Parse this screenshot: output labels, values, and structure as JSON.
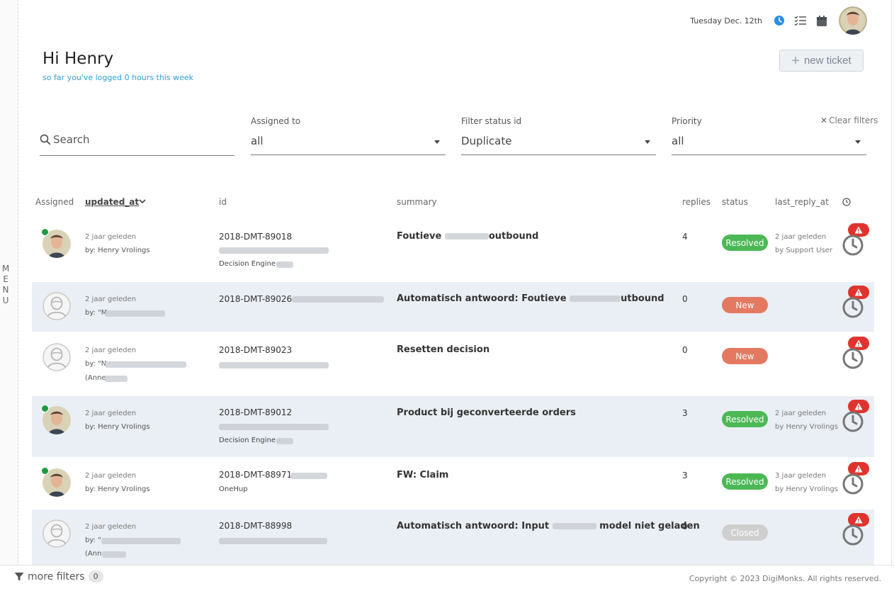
{
  "header": {
    "date": "Tuesday Dec. 12th",
    "greeting": "Hi Henry",
    "subtitle": "so far you've logged 0 hours this week",
    "new_ticket_label": "new ticket",
    "menu_label": "MENU"
  },
  "filters": {
    "search_placeholder": "Search",
    "assigned_label": "Assigned to",
    "assigned_value": "all",
    "status_label": "Filter status id",
    "status_value": "Duplicate",
    "priority_label": "Priority",
    "priority_value": "all",
    "clear_label": "Clear filters"
  },
  "table": {
    "headers": [
      "Assigned",
      "updated_at",
      "id",
      "summary",
      "replies",
      "status",
      "last_reply_at"
    ],
    "rows": [
      {
        "updated": "2 jaar geleden",
        "by": "by: Henry Vrolings",
        "id": "2018-DMT-89018",
        "extra": "Decision Engine - ",
        "summary": "Foutieve",
        "summary2": "outbound",
        "replies": "4",
        "status": "Resolved",
        "last_reply": "2 jaar geleden",
        "last_by": "by Support User"
      },
      {
        "updated": "2 jaar geleden",
        "by": "by: \"M",
        "id": "2018-DMT-89026",
        "extra": "",
        "summary": "Automatisch antwoord: Foutieve",
        "summary2": "utbound",
        "replies": "0",
        "status": "New",
        "last_reply": "",
        "last_by": ""
      },
      {
        "updated": "2 jaar geleden",
        "by": "by: \"N",
        "by2": "(Anne",
        "id": "2018-DMT-89023",
        "extra": "",
        "summary": "Resetten decision",
        "summary2": "",
        "replies": "0",
        "status": "New",
        "last_reply": "",
        "last_by": ""
      },
      {
        "updated": "2 jaar geleden",
        "by": "by: Henry Vrolings",
        "id": "2018-DMT-89012",
        "extra": "Decision Engine - ",
        "summary": "Product bij geconverteerde orders",
        "summary2": "",
        "replies": "3",
        "status": "Resolved",
        "last_reply": "2 jaar geleden",
        "last_by": "by Henry Vrolings"
      },
      {
        "updated": "2 jaar geleden",
        "by": "by: Henry Vrolings",
        "id": "2018-DMT-88971",
        "extra": "OneHup",
        "summary": "FW: Claim",
        "summary2": "",
        "replies": "3",
        "status": "Resolved",
        "last_reply": "3 jaar geleden",
        "last_by": "by Henry Vrolings"
      },
      {
        "updated": "2 jaar geleden",
        "by": "by: \"",
        "by2": "(Ann",
        "id": "2018-DMT-88998",
        "extra": "",
        "summary": "Automatisch antwoord: Input",
        "summary2": "model niet geladen",
        "replies": "0",
        "status": "Closed",
        "last_reply": "",
        "last_by": ""
      }
    ]
  },
  "status_colors": {
    "Resolved": "#4cb855",
    "New": "#e47962",
    "Closed": "#cfcfcf"
  },
  "footer": {
    "more_filters": "more filters",
    "filter_count": "0",
    "copyright": "Copyright © 2023 DigiMonks. All rights reserved."
  }
}
